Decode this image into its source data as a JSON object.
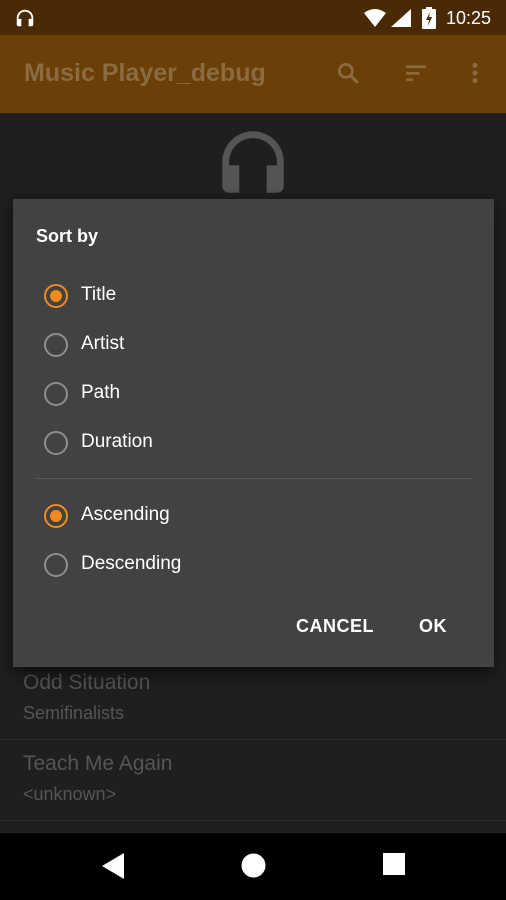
{
  "status_bar": {
    "time": "10:25",
    "icons": [
      "headphones-icon",
      "wifi-icon",
      "signal-icon",
      "battery-icon"
    ]
  },
  "app_bar": {
    "title": "Music Player_debug",
    "actions": [
      "search-icon",
      "sort-icon",
      "more-vert-icon"
    ]
  },
  "songs": [
    {
      "title": "Odd Situation",
      "artist": "Semifinalists"
    },
    {
      "title": "Teach Me Again",
      "artist": "<unknown>"
    }
  ],
  "dialog": {
    "title": "Sort by",
    "sort_options": [
      {
        "label": "Title",
        "checked": true
      },
      {
        "label": "Artist",
        "checked": false
      },
      {
        "label": "Path",
        "checked": false
      },
      {
        "label": "Duration",
        "checked": false
      }
    ],
    "order_options": [
      {
        "label": "Ascending",
        "checked": true
      },
      {
        "label": "Descending",
        "checked": false
      }
    ],
    "cancel_label": "CANCEL",
    "ok_label": "OK"
  },
  "colors": {
    "accent": "#f08a1c",
    "app_bar": "#6b3f08",
    "status_bar": "#4a2a05",
    "dialog_bg": "#424242"
  }
}
